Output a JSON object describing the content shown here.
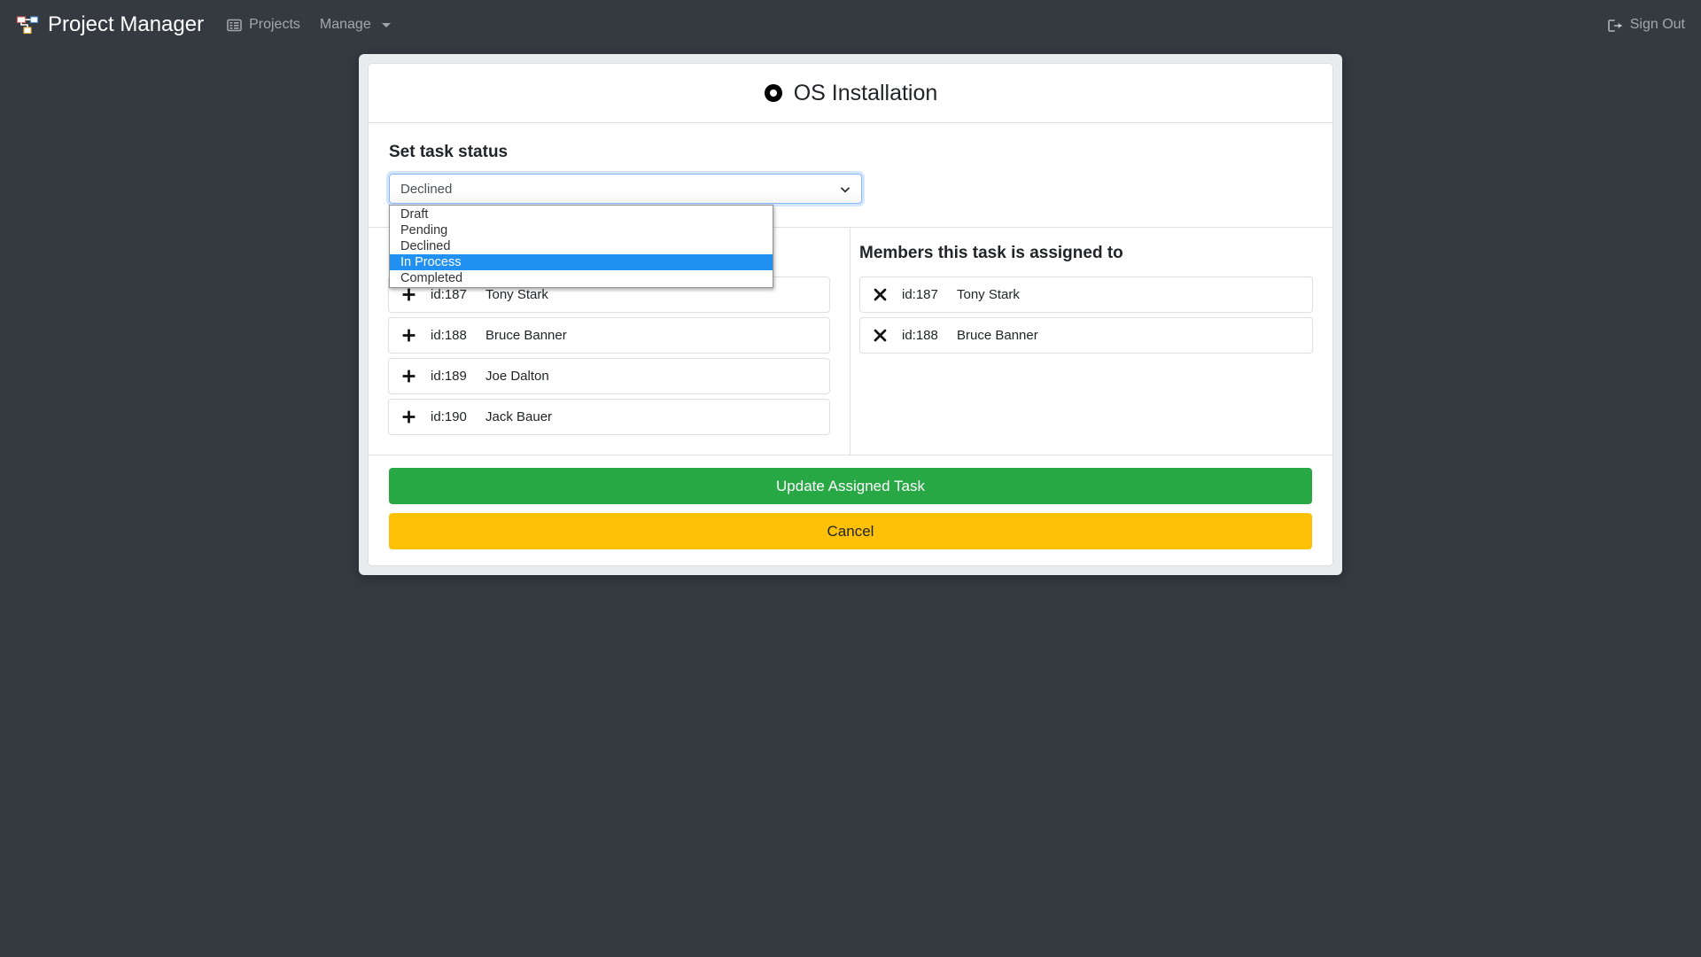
{
  "navbar": {
    "brand": "Project Manager",
    "brand_icon": "sitemap-icon",
    "links": [
      {
        "label": "Projects",
        "icon": "table-list-icon"
      },
      {
        "label": "Manage",
        "icon": "caret-down-icon",
        "has_caret": true
      }
    ],
    "signout": {
      "label": "Sign Out",
      "icon": "sign-out-icon"
    }
  },
  "modal": {
    "title": "OS Installation",
    "title_icon": "dot-circle-icon",
    "status": {
      "label": "Set task status",
      "selected_value": "Declined",
      "expanded": true,
      "highlighted_option": "In Process",
      "options": [
        "Draft",
        "Pending",
        "Declined",
        "In Process",
        "Completed"
      ]
    },
    "available_members": {
      "title": "",
      "items": [
        {
          "icon": "plus-icon",
          "id": "id:187",
          "name": "Tony Stark"
        },
        {
          "icon": "plus-icon",
          "id": "id:188",
          "name": "Bruce Banner"
        },
        {
          "icon": "plus-icon",
          "id": "id:189",
          "name": "Joe Dalton"
        },
        {
          "icon": "plus-icon",
          "id": "id:190",
          "name": "Jack Bauer"
        }
      ]
    },
    "assigned_members": {
      "title": "Members this task is assigned to",
      "items": [
        {
          "icon": "remove-icon",
          "id": "id:187",
          "name": "Tony Stark"
        },
        {
          "icon": "remove-icon",
          "id": "id:188",
          "name": "Bruce Banner"
        }
      ]
    },
    "buttons": {
      "primary": "Update Assigned Task",
      "secondary": "Cancel"
    }
  },
  "colors": {
    "navbar_bg": "#343a40",
    "modal_bg": "#e9ecef",
    "success": "#28a745",
    "warning": "#ffc107",
    "option_highlight": "#2091f0",
    "focus_border": "#86b7fe"
  }
}
